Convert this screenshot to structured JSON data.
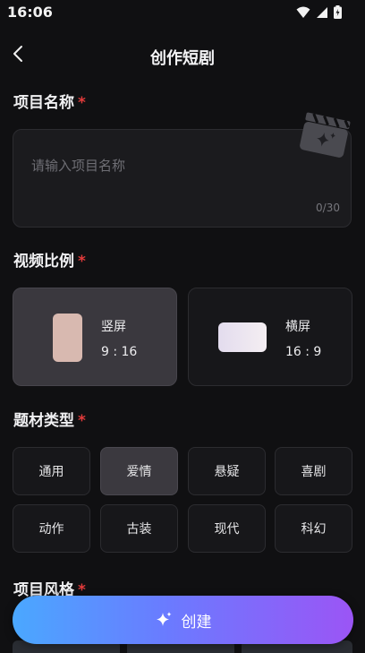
{
  "status_bar": {
    "time": "16:06"
  },
  "header": {
    "title": "创作短剧"
  },
  "project_name": {
    "label": "项目名称",
    "required_mark": "*",
    "placeholder": "请输入项目名称",
    "value": "",
    "counter": "0/30"
  },
  "aspect_ratio": {
    "label": "视频比例",
    "required_mark": "*",
    "options": [
      {
        "name": "竖屏",
        "ratio": "9 : 16",
        "selected": true
      },
      {
        "name": "横屏",
        "ratio": "16 : 9",
        "selected": false
      }
    ]
  },
  "genre": {
    "label": "题材类型",
    "required_mark": "*",
    "options": [
      "通用",
      "爱情",
      "悬疑",
      "喜剧",
      "动作",
      "古装",
      "现代",
      "科幻"
    ],
    "selected": "爱情"
  },
  "style": {
    "label": "项目风格",
    "required_mark": "*"
  },
  "create_button": {
    "label": "创建",
    "icon": "sparkle-icon"
  },
  "colors": {
    "background": "#101012",
    "required": "#E23B3B",
    "gradient_start": "#4AA8FF",
    "gradient_end": "#9B55F5",
    "selected_card": "#3A383E"
  }
}
